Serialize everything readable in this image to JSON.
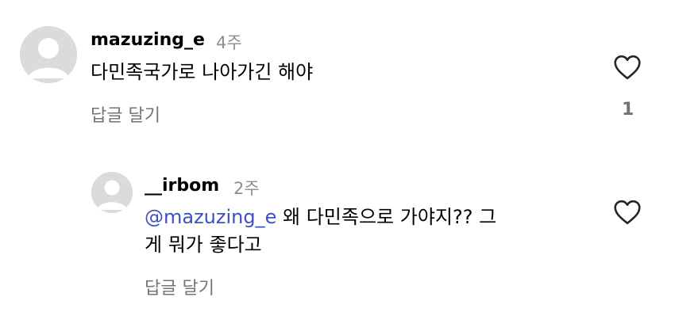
{
  "comments": [
    {
      "username": "mazuzing_e",
      "time": "4주",
      "text": "다민족국가로 나아가긴 해야",
      "reply_label": "답글 달기",
      "like_count": "1"
    },
    {
      "username": "__irbom",
      "time": "2주",
      "mention": "@mazuzing_e",
      "text_line1": " 왜 다민족으로 가야지?? 그",
      "text_line2": "게 뭐가 좋다고",
      "reply_label": "답글 달기"
    }
  ],
  "icons": {
    "avatar": "default-avatar-icon",
    "like": "heart-outline-icon"
  },
  "colors": {
    "mention": "#3d4fc4",
    "secondary_text": "#737373",
    "avatar_bg": "#dbdbdb"
  }
}
